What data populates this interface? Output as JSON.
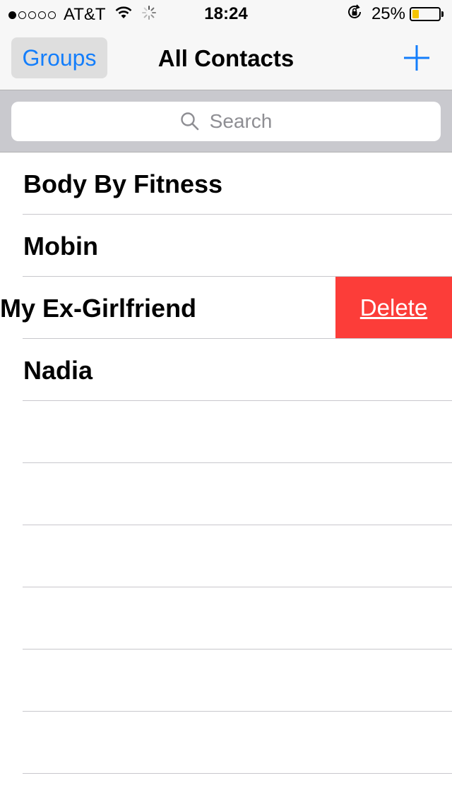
{
  "status_bar": {
    "signal_dots": [
      true,
      false,
      false,
      false,
      false
    ],
    "carrier": "AT&T",
    "time": "18:24",
    "battery_percent": "25%",
    "battery_level": 0.25,
    "battery_color": "#f5c500",
    "icons": [
      "wifi-icon",
      "activity-spinner-icon",
      "rotation-lock-icon",
      "battery-icon"
    ]
  },
  "nav_bar": {
    "groups_label": "Groups",
    "title": "All Contacts",
    "add_icon": "plus-icon",
    "accent_color": "#147efb"
  },
  "search": {
    "placeholder": "Search",
    "icon": "search-icon"
  },
  "contacts": [
    {
      "name": "Body By Fitness"
    },
    {
      "name": "Mobin"
    },
    {
      "name": "My Ex-Girlfriend",
      "swiped": true,
      "action_label": "Delete",
      "action_color": "#fc3d39"
    },
    {
      "name": "Nadia"
    }
  ],
  "empty_rows": 6
}
